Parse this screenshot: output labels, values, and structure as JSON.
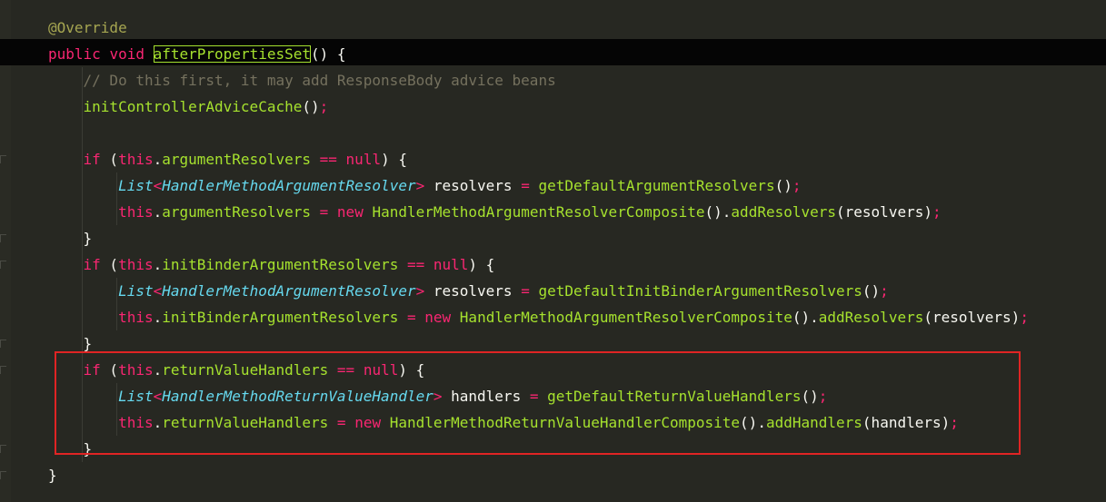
{
  "editor": {
    "lines": [
      [
        {
          "t": "@Override",
          "c": "ann"
        }
      ],
      [
        {
          "t": "public",
          "c": "kw"
        },
        {
          "t": " ",
          "c": "pl"
        },
        {
          "t": "void",
          "c": "kw"
        },
        {
          "t": " ",
          "c": "pl"
        },
        {
          "t": "afterPropertiesSet",
          "c": "fn hl"
        },
        {
          "t": "() {",
          "c": "pl"
        }
      ],
      [
        {
          "t": "    // Do this first, it may add ResponseBody advice beans",
          "c": "cm"
        }
      ],
      [
        {
          "t": "    ",
          "c": "pl"
        },
        {
          "t": "initControllerAdviceCache",
          "c": "fn"
        },
        {
          "t": "()",
          "c": "pl"
        },
        {
          "t": ";",
          "c": "op"
        }
      ],
      [],
      [
        {
          "t": "    ",
          "c": "pl"
        },
        {
          "t": "if",
          "c": "kw"
        },
        {
          "t": " (",
          "c": "pl"
        },
        {
          "t": "this",
          "c": "kw"
        },
        {
          "t": ".",
          "c": "pl"
        },
        {
          "t": "argumentResolvers",
          "c": "fn"
        },
        {
          "t": " ",
          "c": "pl"
        },
        {
          "t": "==",
          "c": "op"
        },
        {
          "t": " ",
          "c": "pl"
        },
        {
          "t": "null",
          "c": "kw"
        },
        {
          "t": ") {",
          "c": "pl"
        }
      ],
      [
        {
          "t": "        ",
          "c": "pl"
        },
        {
          "t": "List",
          "c": "ty"
        },
        {
          "t": "<",
          "c": "op"
        },
        {
          "t": "HandlerMethodArgumentResolver",
          "c": "ty"
        },
        {
          "t": ">",
          "c": "op"
        },
        {
          "t": " resolvers ",
          "c": "pl"
        },
        {
          "t": "=",
          "c": "op"
        },
        {
          "t": " ",
          "c": "pl"
        },
        {
          "t": "getDefaultArgumentResolvers",
          "c": "fn"
        },
        {
          "t": "()",
          "c": "pl"
        },
        {
          "t": ";",
          "c": "op"
        }
      ],
      [
        {
          "t": "        ",
          "c": "pl"
        },
        {
          "t": "this",
          "c": "kw"
        },
        {
          "t": ".",
          "c": "pl"
        },
        {
          "t": "argumentResolvers",
          "c": "fn"
        },
        {
          "t": " ",
          "c": "pl"
        },
        {
          "t": "=",
          "c": "op"
        },
        {
          "t": " ",
          "c": "pl"
        },
        {
          "t": "new",
          "c": "kw"
        },
        {
          "t": " ",
          "c": "pl"
        },
        {
          "t": "HandlerMethodArgumentResolverComposite",
          "c": "cl"
        },
        {
          "t": "()",
          "c": "pl"
        },
        {
          "t": ".",
          "c": "pl"
        },
        {
          "t": "addResolvers",
          "c": "fn"
        },
        {
          "t": "(resolvers)",
          "c": "pl"
        },
        {
          "t": ";",
          "c": "op"
        }
      ],
      [
        {
          "t": "    }",
          "c": "pl"
        }
      ],
      [
        {
          "t": "    ",
          "c": "pl"
        },
        {
          "t": "if",
          "c": "kw"
        },
        {
          "t": " (",
          "c": "pl"
        },
        {
          "t": "this",
          "c": "kw"
        },
        {
          "t": ".",
          "c": "pl"
        },
        {
          "t": "initBinderArgumentResolvers",
          "c": "fn"
        },
        {
          "t": " ",
          "c": "pl"
        },
        {
          "t": "==",
          "c": "op"
        },
        {
          "t": " ",
          "c": "pl"
        },
        {
          "t": "null",
          "c": "kw"
        },
        {
          "t": ") {",
          "c": "pl"
        }
      ],
      [
        {
          "t": "        ",
          "c": "pl"
        },
        {
          "t": "List",
          "c": "ty"
        },
        {
          "t": "<",
          "c": "op"
        },
        {
          "t": "HandlerMethodArgumentResolver",
          "c": "ty"
        },
        {
          "t": ">",
          "c": "op"
        },
        {
          "t": " resolvers ",
          "c": "pl"
        },
        {
          "t": "=",
          "c": "op"
        },
        {
          "t": " ",
          "c": "pl"
        },
        {
          "t": "getDefaultInitBinderArgumentResolvers",
          "c": "fn"
        },
        {
          "t": "()",
          "c": "pl"
        },
        {
          "t": ";",
          "c": "op"
        }
      ],
      [
        {
          "t": "        ",
          "c": "pl"
        },
        {
          "t": "this",
          "c": "kw"
        },
        {
          "t": ".",
          "c": "pl"
        },
        {
          "t": "initBinderArgumentResolvers",
          "c": "fn"
        },
        {
          "t": " ",
          "c": "pl"
        },
        {
          "t": "=",
          "c": "op"
        },
        {
          "t": " ",
          "c": "pl"
        },
        {
          "t": "new",
          "c": "kw"
        },
        {
          "t": " ",
          "c": "pl"
        },
        {
          "t": "HandlerMethodArgumentResolverComposite",
          "c": "cl"
        },
        {
          "t": "()",
          "c": "pl"
        },
        {
          "t": ".",
          "c": "pl"
        },
        {
          "t": "addResolvers",
          "c": "fn"
        },
        {
          "t": "(resolvers)",
          "c": "pl"
        },
        {
          "t": ";",
          "c": "op"
        }
      ],
      [
        {
          "t": "    }",
          "c": "pl"
        }
      ],
      [
        {
          "t": "    ",
          "c": "pl"
        },
        {
          "t": "if",
          "c": "kw"
        },
        {
          "t": " (",
          "c": "pl"
        },
        {
          "t": "this",
          "c": "kw"
        },
        {
          "t": ".",
          "c": "pl"
        },
        {
          "t": "returnValueHandlers",
          "c": "fn"
        },
        {
          "t": " ",
          "c": "pl"
        },
        {
          "t": "==",
          "c": "op"
        },
        {
          "t": " ",
          "c": "pl"
        },
        {
          "t": "null",
          "c": "kw"
        },
        {
          "t": ") {",
          "c": "pl"
        }
      ],
      [
        {
          "t": "        ",
          "c": "pl"
        },
        {
          "t": "List",
          "c": "ty"
        },
        {
          "t": "<",
          "c": "op"
        },
        {
          "t": "HandlerMethodReturnValueHandler",
          "c": "ty"
        },
        {
          "t": ">",
          "c": "op"
        },
        {
          "t": " handlers ",
          "c": "pl"
        },
        {
          "t": "=",
          "c": "op"
        },
        {
          "t": " ",
          "c": "pl"
        },
        {
          "t": "getDefaultReturnValueHandlers",
          "c": "fn"
        },
        {
          "t": "()",
          "c": "pl"
        },
        {
          "t": ";",
          "c": "op"
        }
      ],
      [
        {
          "t": "        ",
          "c": "pl"
        },
        {
          "t": "this",
          "c": "kw"
        },
        {
          "t": ".",
          "c": "pl"
        },
        {
          "t": "returnValueHandlers",
          "c": "fn"
        },
        {
          "t": " ",
          "c": "pl"
        },
        {
          "t": "=",
          "c": "op"
        },
        {
          "t": " ",
          "c": "pl"
        },
        {
          "t": "new",
          "c": "kw"
        },
        {
          "t": " ",
          "c": "pl"
        },
        {
          "t": "HandlerMethodReturnValueHandlerComposite",
          "c": "cl"
        },
        {
          "t": "()",
          "c": "pl"
        },
        {
          "t": ".",
          "c": "pl"
        },
        {
          "t": "addHandlers",
          "c": "fn"
        },
        {
          "t": "(handlers)",
          "c": "pl"
        },
        {
          "t": ";",
          "c": "op"
        }
      ],
      [
        {
          "t": "    }",
          "c": "pl"
        }
      ],
      [
        {
          "t": "}",
          "c": "pl"
        }
      ]
    ]
  },
  "colors": {
    "background": "#272822",
    "caret_line": "#050505",
    "keyword": "#f92672",
    "function": "#a6e22e",
    "type": "#66d9ef",
    "comment": "#75715e",
    "annotation": "#a6a651",
    "highlight_box": "#e02424"
  }
}
